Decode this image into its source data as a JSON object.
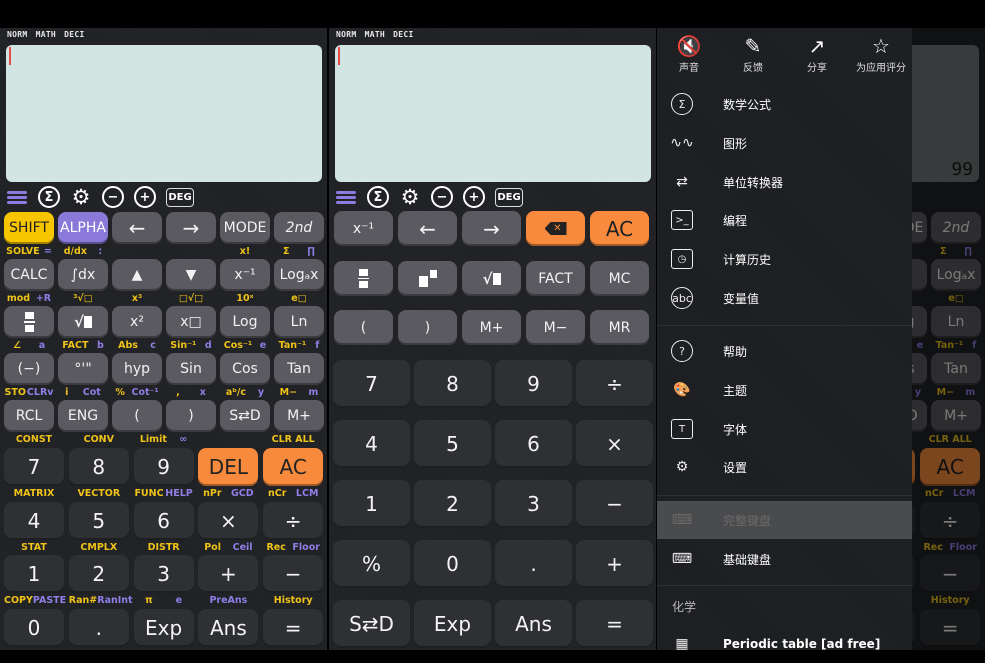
{
  "status": "NORM  MATH  DECI",
  "toolbar": {
    "deg": "DEG",
    "sigma": "Σ",
    "minus": "−",
    "plus": "+",
    "gear": "⚙"
  },
  "full": {
    "rows6": [
      [
        {
          "t": "SHIFT",
          "c": "shift"
        },
        {
          "t": "ALPHA",
          "c": "alpha"
        },
        {
          "t": "←",
          "c": "big"
        },
        {
          "t": "→",
          "c": "big"
        },
        {
          "t": "MODE"
        },
        {
          "t": "2nd",
          "c": "it"
        }
      ],
      [
        {
          "t": "CALC"
        },
        {
          "t": "∫dx"
        },
        {
          "t": "▲"
        },
        {
          "t": "▼"
        },
        {
          "t": "x⁻¹"
        },
        {
          "t": "Logₐx"
        }
      ],
      [
        {
          "icon": "fraction"
        },
        {
          "icon": "sqrt"
        },
        {
          "t": "x²"
        },
        {
          "t": "x□"
        },
        {
          "t": "Log"
        },
        {
          "t": "Ln"
        }
      ],
      [
        {
          "t": "(−)"
        },
        {
          "t": "°'\""
        },
        {
          "t": "hyp"
        },
        {
          "t": "Sin"
        },
        {
          "t": "Cos"
        },
        {
          "t": "Tan"
        }
      ],
      [
        {
          "t": "RCL"
        },
        {
          "t": "ENG"
        },
        {
          "t": "("
        },
        {
          "t": ")"
        },
        {
          "t": "S⇄D"
        },
        {
          "t": "M+"
        }
      ]
    ],
    "labels6": [
      [
        [
          "SOLVE",
          "="
        ],
        [
          "d/dx",
          ":"
        ],
        [
          "",
          ""
        ],
        [
          "",
          ""
        ],
        [
          "x!",
          ""
        ],
        [
          "Σ",
          "∏"
        ]
      ],
      [
        [
          "mod",
          "+R"
        ],
        [
          "³√□",
          ""
        ],
        [
          "x³",
          ""
        ],
        [
          "□√□",
          ""
        ],
        [
          "10ˣ",
          ""
        ],
        [
          "e□",
          ""
        ]
      ],
      [
        [
          "∠",
          "a"
        ],
        [
          "FACT",
          "b"
        ],
        [
          "Abs",
          "c"
        ],
        [
          "Sin⁻¹",
          "d"
        ],
        [
          "Cos⁻¹",
          "e"
        ],
        [
          "Tan⁻¹",
          "f"
        ]
      ],
      [
        [
          "STO",
          "CLRv"
        ],
        [
          "i",
          "Cot"
        ],
        [
          "%",
          "Cot⁻¹"
        ],
        [
          ",",
          "x"
        ],
        [
          "aᵇ/c",
          "y"
        ],
        [
          "M−",
          "m"
        ]
      ],
      [
        [
          "CONST",
          ""
        ],
        [
          "CONV",
          ""
        ],
        [
          "Limit",
          "∞"
        ],
        [
          "",
          ""
        ],
        [
          "CLR ALL",
          ""
        ]
      ]
    ],
    "rows5": [
      [
        {
          "t": "7"
        },
        {
          "t": "8"
        },
        {
          "t": "9"
        },
        {
          "t": "DEL",
          "c": "orange"
        },
        {
          "t": "AC",
          "c": "orange"
        }
      ],
      [
        {
          "t": "4"
        },
        {
          "t": "5"
        },
        {
          "t": "6"
        },
        {
          "t": "×"
        },
        {
          "t": "÷"
        }
      ],
      [
        {
          "t": "1"
        },
        {
          "t": "2"
        },
        {
          "t": "3"
        },
        {
          "t": "+"
        },
        {
          "t": "−"
        }
      ],
      [
        {
          "t": "0"
        },
        {
          "t": "."
        },
        {
          "t": "Exp"
        },
        {
          "t": "Ans"
        },
        {
          "t": "="
        }
      ]
    ],
    "labels5": [
      [
        [
          "MATRIX",
          ""
        ],
        [
          "VECTOR",
          ""
        ],
        [
          "FUNC",
          "HELP"
        ],
        [
          "nPr",
          "GCD"
        ],
        [
          "nCr",
          "LCM"
        ]
      ],
      [
        [
          "STAT",
          ""
        ],
        [
          "CMPLX",
          ""
        ],
        [
          "DISTR",
          ""
        ],
        [
          "Pol",
          "Ceil"
        ],
        [
          "Rec",
          "Floor"
        ]
      ],
      [
        [
          "COPY",
          "PASTE"
        ],
        [
          "Ran#",
          "RanInt"
        ],
        [
          "π",
          "e"
        ],
        [
          "",
          "PreAns"
        ],
        [
          "History",
          ""
        ]
      ]
    ]
  },
  "basic": {
    "rows": [
      [
        {
          "t": "x⁻¹"
        },
        {
          "t": "←",
          "c": "big"
        },
        {
          "t": "→",
          "c": "big"
        },
        {
          "icon": "backspace",
          "c": "orange"
        },
        {
          "t": "AC",
          "c": "orange"
        }
      ],
      [
        {
          "icon": "fraction"
        },
        {
          "icon": "mixed-fraction"
        },
        {
          "icon": "sqrt"
        },
        {
          "t": "FACT"
        },
        {
          "t": "MC"
        }
      ],
      [
        {
          "t": "("
        },
        {
          "t": ")"
        },
        {
          "t": "M+"
        },
        {
          "t": "M−"
        },
        {
          "t": "MR"
        }
      ]
    ],
    "numpad": [
      [
        {
          "t": "7"
        },
        {
          "t": "8"
        },
        {
          "t": "9"
        },
        {
          "t": "÷"
        }
      ],
      [
        {
          "t": "4"
        },
        {
          "t": "5"
        },
        {
          "t": "6"
        },
        {
          "t": "×"
        }
      ],
      [
        {
          "t": "1"
        },
        {
          "t": "2"
        },
        {
          "t": "3"
        },
        {
          "t": "−"
        }
      ],
      [
        {
          "t": "%"
        },
        {
          "t": "0"
        },
        {
          "t": "."
        },
        {
          "t": "+"
        }
      ],
      [
        {
          "t": "S⇄D"
        },
        {
          "t": "Exp"
        },
        {
          "t": "Ans"
        },
        {
          "t": "="
        }
      ]
    ]
  },
  "background": {
    "result": "99"
  },
  "drawer": {
    "top": [
      {
        "label": "声音",
        "icon": "mute-icon",
        "g": "🔇"
      },
      {
        "label": "反馈",
        "icon": "feedback-icon",
        "g": "✎"
      },
      {
        "label": "分享",
        "icon": "share-icon",
        "g": "↗"
      },
      {
        "label": "为应用评分",
        "icon": "star-icon",
        "g": "☆"
      }
    ],
    "items": [
      {
        "label": "数学公式",
        "icon": "sigma-icon",
        "g": "Σ"
      },
      {
        "label": "图形",
        "icon": "graph-icon",
        "g": "∿∿"
      },
      {
        "label": "单位转换器",
        "icon": "convert-icon",
        "g": "⇄"
      },
      {
        "label": "编程",
        "icon": "terminal-icon",
        "g": ">_"
      },
      {
        "label": "计算历史",
        "icon": "history-icon",
        "g": "◷"
      },
      {
        "label": "变量值",
        "icon": "abc-icon",
        "g": "abc"
      },
      {
        "label": "帮助",
        "icon": "help-icon",
        "g": "?"
      },
      {
        "label": "主题",
        "icon": "palette-icon",
        "g": "🎨"
      },
      {
        "label": "字体",
        "icon": "font-icon",
        "g": "T"
      },
      {
        "label": "设置",
        "icon": "gear-icon",
        "g": "⚙"
      },
      {
        "label": "完整键盘",
        "icon": "keyboard-icon",
        "g": "⌨",
        "selected": true
      },
      {
        "label": "基础键盘",
        "icon": "keyboard-icon",
        "g": "⌨"
      }
    ],
    "section": "化学",
    "periodic": {
      "label": "Periodic table [ad free]",
      "icon": "periodic-table-icon",
      "g": "▦"
    }
  },
  "colors": {
    "shift": "#f7c600",
    "alpha": "#8a79d8",
    "orange": "#f78a3d",
    "screen": "#d2e5e2"
  }
}
